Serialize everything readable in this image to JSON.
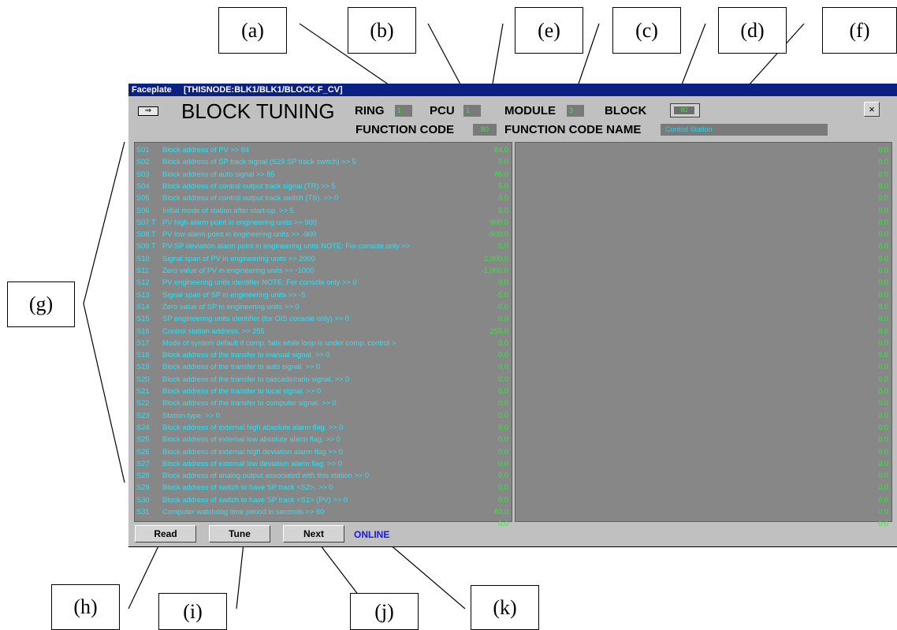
{
  "callouts": {
    "a": "(a)",
    "b": "(b)",
    "e": "(e)",
    "c": "(c)",
    "d": "(d)",
    "f": "(f)",
    "g": "(g)",
    "h": "(h)",
    "i": "(i)",
    "j": "(j)",
    "k": "(k)"
  },
  "window": {
    "title": "Faceplate     [THISNODE:BLK1/BLK1/BLOCK.F_CV]",
    "heading": "BLOCK TUNING",
    "ring_label": "RING",
    "ring_value": "1",
    "pcu_label": "PCU",
    "pcu_value": "1",
    "module_label": "MODULE",
    "module_value": "3",
    "block_label": "BLOCK",
    "block_value": "80",
    "fc_label": "FUNCTION CODE",
    "fc_value": "80",
    "fcname_label": "FUNCTION CODE NAME",
    "fcname_value": "Control Station",
    "close_label": "×"
  },
  "left_rows": [
    {
      "id": "S01",
      "desc": "Block address of PV >> 84",
      "val": "84.0"
    },
    {
      "id": "S02",
      "desc": "Block address of SP track signal  (S29 SP track switch) >> 5",
      "val": "5.0"
    },
    {
      "id": "S03",
      "desc": "Block address of auto signal >> 85",
      "val": "85.0"
    },
    {
      "id": "S04",
      "desc": "Block address of control output track signal (TR) >> 5",
      "val": "5.0"
    },
    {
      "id": "S05",
      "desc": "Block address of control output track switch (TS). >> 0",
      "val": "0.0"
    },
    {
      "id": "S06",
      "desc": "Initial mode of station after start-up. >> 5",
      "val": "5.0"
    },
    {
      "id": "S07 T",
      "desc": "PV high alarm point in engineering units >> 900",
      "val": "900.0"
    },
    {
      "id": "S08 T",
      "desc": "PV low alarm point in engineering units >> -900",
      "val": "-900.0"
    },
    {
      "id": "S09 T",
      "desc": "PV-SP deviation alarm point in engineering units NOTE: For console only >>",
      "val": "0.0"
    },
    {
      "id": "S10",
      "desc": "Signal span of PV in engineering units >> 2000",
      "val": "2,000.0"
    },
    {
      "id": "S11",
      "desc": "Zero value of PV in engineering units >> -1000",
      "val": "-1,000.0"
    },
    {
      "id": "S12",
      "desc": "PV engineering units identifier NOTE: For console only >> 0",
      "val": "0.0"
    },
    {
      "id": "S13",
      "desc": "Signal span of SP in engineering units >> -5",
      "val": "-5.0"
    },
    {
      "id": "S14",
      "desc": "Zero value of SP in engineering units >> 0",
      "val": "0.0"
    },
    {
      "id": "S15",
      "desc": "SP engineering units identifier (for OIS console only) >> 0",
      "val": "0.0"
    },
    {
      "id": "S16",
      "desc": "Control station address. >> 255",
      "val": "255.0"
    },
    {
      "id": "S17",
      "desc": "Mode of system default if comp. fails while loop is under comp. control >",
      "val": "0.0"
    },
    {
      "id": "S18",
      "desc": "Block address of the transfer to manual signal. >> 0",
      "val": "0.0"
    },
    {
      "id": "S19",
      "desc": "Block address of the transfer to auto signal. >> 0",
      "val": "0.0"
    },
    {
      "id": "S20",
      "desc": "Block address of the transfer to cascade/ratio signal. >> 0",
      "val": "0.0"
    },
    {
      "id": "S21",
      "desc": "Block address of the transfer to local signal. >> 0",
      "val": "0.0"
    },
    {
      "id": "S22",
      "desc": "Block address of the transfer to computer signal. >> 0",
      "val": "0.0"
    },
    {
      "id": "S23",
      "desc": "Station type. >> 0",
      "val": "0.0"
    },
    {
      "id": "S24",
      "desc": "Block address of external high absolute alarm flag. >> 0",
      "val": "0.0"
    },
    {
      "id": "S25",
      "desc": "Block address of external low absolute alarm flag. >> 0",
      "val": "0.0"
    },
    {
      "id": "S26",
      "desc": "Block address of external high deviation alarm flag >> 0",
      "val": "0.0"
    },
    {
      "id": "S27",
      "desc": "Block address of external low deviation alarm flag. >> 0",
      "val": "0.0"
    },
    {
      "id": "S28",
      "desc": "Block address of analog output associated with this station >> 0",
      "val": "0.0"
    },
    {
      "id": "S29",
      "desc": "Block address of switch to have SP track <S2>. >> 0",
      "val": "0.0"
    },
    {
      "id": "S30",
      "desc": "Block address of switch to have SP track <S1> (PV) >> 0",
      "val": "0.0"
    },
    {
      "id": "S31",
      "desc": "Computer watchdog time period in seconds >> 60",
      "val": "60.0"
    },
    {
      "id": "",
      "desc": "",
      "val": "0.0"
    }
  ],
  "right_values": [
    "0.0",
    "0.0",
    "0.0",
    "0.0",
    "0.0",
    "0.0",
    "0.0",
    "0.0",
    "0.0",
    "0.0",
    "0.0",
    "0.0",
    "0.0",
    "0.0",
    "0.0",
    "0.0",
    "0.0",
    "0.0",
    "0.0",
    "0.0",
    "0.0",
    "0.0",
    "0.0",
    "0.0",
    "0.0",
    "0.0",
    "0.0",
    "0.0",
    "0.0",
    "0.0",
    "0.0",
    "0.0"
  ],
  "buttons": {
    "read": "Read",
    "tune": "Tune",
    "next": "Next"
  },
  "status": "ONLINE"
}
